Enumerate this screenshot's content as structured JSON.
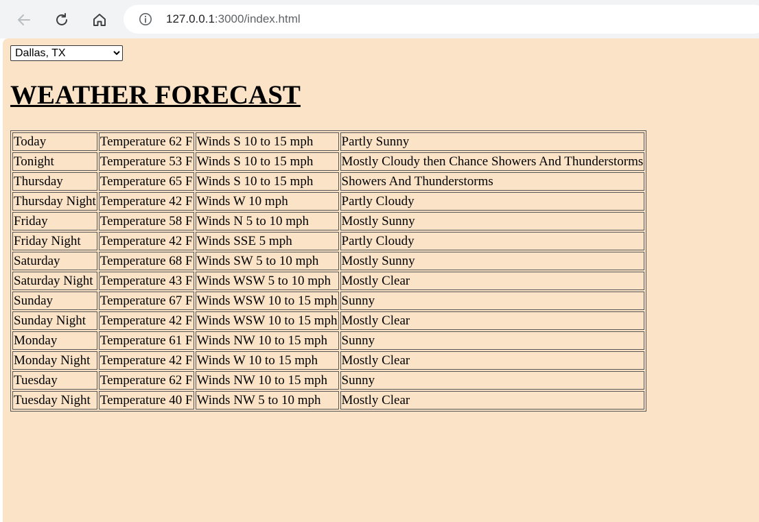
{
  "browser": {
    "url_host": "127.0.0.1",
    "url_rest": ":3000/index.html"
  },
  "location_select": {
    "selected": "Dallas, TX"
  },
  "page_title": "WEATHER FORECAST",
  "forecast": [
    {
      "period": "Today",
      "temp": "Temperature 62 F",
      "wind": "Winds S 10 to 15 mph",
      "condition": "Partly Sunny"
    },
    {
      "period": "Tonight",
      "temp": "Temperature 53 F",
      "wind": "Winds S 10 to 15 mph",
      "condition": "Mostly Cloudy then Chance Showers And Thunderstorms"
    },
    {
      "period": "Thursday",
      "temp": "Temperature 65 F",
      "wind": "Winds S 10 to 15 mph",
      "condition": "Showers And Thunderstorms"
    },
    {
      "period": "Thursday Night",
      "temp": "Temperature 42 F",
      "wind": "Winds W 10 mph",
      "condition": "Partly Cloudy"
    },
    {
      "period": "Friday",
      "temp": "Temperature 58 F",
      "wind": "Winds N 5 to 10 mph",
      "condition": "Mostly Sunny"
    },
    {
      "period": "Friday Night",
      "temp": "Temperature 42 F",
      "wind": "Winds SSE 5 mph",
      "condition": "Partly Cloudy"
    },
    {
      "period": "Saturday",
      "temp": "Temperature 68 F",
      "wind": "Winds SW 5 to 10 mph",
      "condition": "Mostly Sunny"
    },
    {
      "period": "Saturday Night",
      "temp": "Temperature 43 F",
      "wind": "Winds WSW 5 to 10 mph",
      "condition": "Mostly Clear"
    },
    {
      "period": "Sunday",
      "temp": "Temperature 67 F",
      "wind": "Winds WSW 10 to 15 mph",
      "condition": "Sunny"
    },
    {
      "period": "Sunday Night",
      "temp": "Temperature 42 F",
      "wind": "Winds WSW 10 to 15 mph",
      "condition": "Mostly Clear"
    },
    {
      "period": "Monday",
      "temp": "Temperature 61 F",
      "wind": "Winds NW 10 to 15 mph",
      "condition": "Sunny"
    },
    {
      "period": "Monday Night",
      "temp": "Temperature 42 F",
      "wind": "Winds W 10 to 15 mph",
      "condition": "Mostly Clear"
    },
    {
      "period": "Tuesday",
      "temp": "Temperature 62 F",
      "wind": "Winds NW 10 to 15 mph",
      "condition": "Sunny"
    },
    {
      "period": "Tuesday Night",
      "temp": "Temperature 40 F",
      "wind": "Winds NW 5 to 10 mph",
      "condition": "Mostly Clear"
    }
  ],
  "colors": {
    "page_background": "#fae3c7",
    "chrome_background": "#f1f3f4"
  },
  "icons": {
    "back": "back-arrow-icon",
    "reload": "reload-icon",
    "home": "home-icon",
    "info": "info-icon"
  }
}
